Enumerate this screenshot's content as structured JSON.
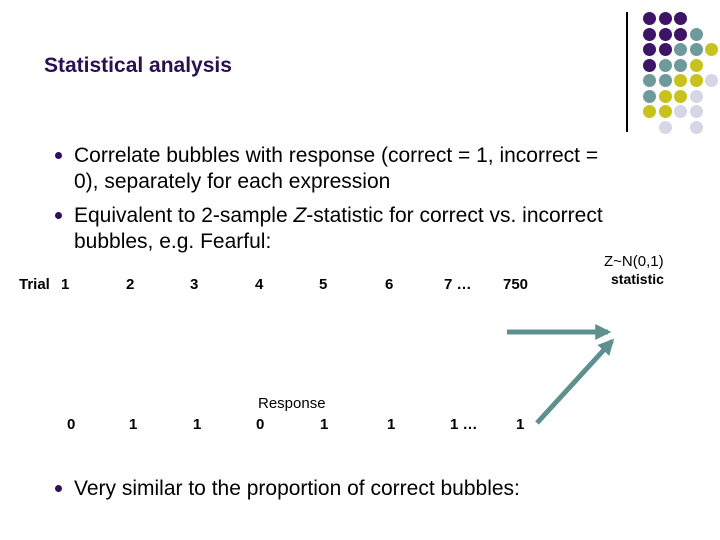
{
  "slide": {
    "title": "Statistical analysis",
    "bullets": [
      {
        "line1": "Correlate bubbles with response (correct = 1, incorrect =",
        "line2": "0), separately for each expression"
      },
      {
        "line1_pre": "Equivalent to 2-sample ",
        "line1_italic": "Z",
        "line1_post": "-statistic for correct vs. incorrect",
        "line2": "bubbles, e.g. Fearful:"
      },
      {
        "line1": "Very similar to the proportion of correct bubbles:"
      }
    ],
    "trial_row": {
      "label": "Trial",
      "values": [
        "1",
        "2",
        "3",
        "4",
        "5",
        "6",
        "7 …",
        "750"
      ]
    },
    "response_label": "Response",
    "response_row": {
      "values": [
        "0",
        "1",
        "1",
        "0",
        "1",
        "1",
        "1 …",
        "1"
      ]
    },
    "statistic": {
      "line1": "Z~N(0,1)",
      "line2": "statistic"
    }
  },
  "decoration": {
    "colors": {
      "purple": "#3d1466",
      "teal": "#6f9a9c",
      "yellow": "#c8c21c",
      "light": "#d6d6e6",
      "arrow": "#5f9090",
      "title": "#2a1050",
      "bullet": "#2e0f5e"
    },
    "dot_grid": [
      [
        "purple",
        "purple",
        "purple"
      ],
      [
        "purple",
        "purple",
        "purple",
        "teal"
      ],
      [
        "purple",
        "purple",
        "teal",
        "teal",
        "yellow"
      ],
      [
        "purple",
        "teal",
        "teal",
        "yellow"
      ],
      [
        "teal",
        "teal",
        "yellow",
        "yellow",
        "light"
      ],
      [
        "teal",
        "yellow",
        "yellow",
        "light"
      ],
      [
        "yellow",
        "yellow",
        "light",
        "light"
      ],
      [
        "",
        "light",
        "",
        "light"
      ]
    ]
  }
}
